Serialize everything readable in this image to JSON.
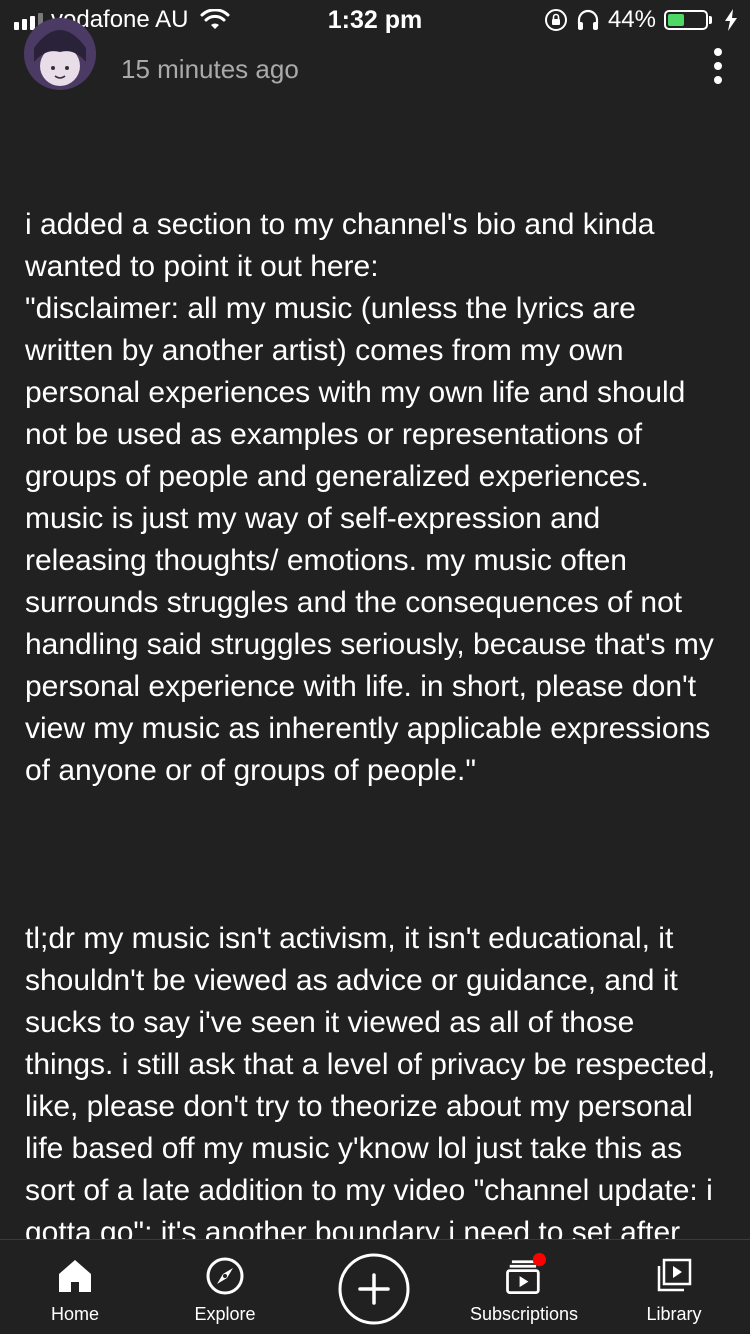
{
  "status_bar": {
    "carrier": "vodafone AU",
    "time": "1:32 pm",
    "battery_percent": "44%",
    "battery_level": 0.44,
    "icons": [
      "signal-icon",
      "wifi-icon",
      "rotation-lock-icon",
      "headphones-icon",
      "battery-icon",
      "charging-bolt-icon"
    ]
  },
  "post": {
    "timestamp": "15 minutes ago",
    "paragraphs": [
      "i added a section to my channel's bio and kinda wanted to point it out here:\n\"disclaimer: all my music (unless the lyrics are written by another artist) comes from my own personal experiences with my own life and should not be used as examples or representations of groups of people and generalized experiences. music is just my way of self-expression and releasing thoughts/ emotions. my music often surrounds struggles and the consequences of not handling said struggles seriously, because that's my personal experience with life. in short, please don't view my music as inherently applicable expressions of anyone or of groups of people.\"",
      "tl;dr my music isn't activism, it isn't educational, it shouldn't be viewed as advice or guidance, and it sucks to say i've seen it viewed as all of those things. i still ask that a level of privacy be respected, like, please don't try to theorize about my personal life based off my music y'know lol just take this as sort of a late addition to my video \"channel update: i gotta go\"; it's another boundary i need to set after reviewing my time as a creator with an audience"
    ]
  },
  "bottom_nav": {
    "items": [
      {
        "label": "Home",
        "icon": "home-icon"
      },
      {
        "label": "Explore",
        "icon": "compass-icon"
      },
      {
        "label": "",
        "icon": "plus-icon"
      },
      {
        "label": "Subscriptions",
        "icon": "subscriptions-icon"
      },
      {
        "label": "Library",
        "icon": "library-icon"
      }
    ]
  },
  "colors": {
    "background": "#212121",
    "text": "#ffffff",
    "muted_text": "#aaaaaa",
    "notification_dot": "#ff0000",
    "battery_fill": "#4cd964"
  }
}
